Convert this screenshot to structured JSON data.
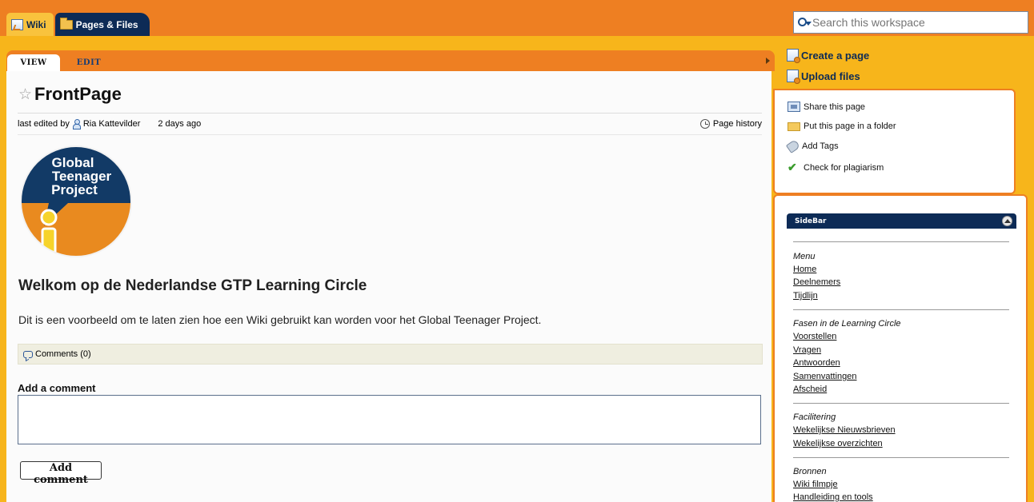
{
  "tabs": {
    "wiki": "Wiki",
    "pages_files": "Pages & Files"
  },
  "search": {
    "placeholder": "Search this workspace"
  },
  "page_tabs": {
    "view": "VIEW",
    "edit": "EDIT"
  },
  "page": {
    "title": "FrontPage",
    "last_edited_prefix": "last edited by",
    "editor": "Ria Kattevilder",
    "edited_ago": "2 days ago",
    "history": "Page history",
    "logo_lines": [
      "Global",
      "Teenager",
      "Project"
    ],
    "heading": "Welkom op de Nederlandse GTP Learning Circle",
    "paragraph": "Dit is een voorbeeld om te laten zien hoe een Wiki gebruikt kan worden voor het Global Teenager Project.",
    "comments": "Comments (0)",
    "add_comment_label": "Add a comment",
    "add_comment_button": "Add comment"
  },
  "right": {
    "create_page": "Create a page",
    "upload_files": "Upload files",
    "actions": [
      "Share this page",
      "Put this page in a folder",
      "Add Tags",
      "Check for plagiarism"
    ]
  },
  "sidebar": {
    "title": "SideBar",
    "sections": [
      {
        "heading": "Menu",
        "links": [
          "Home",
          "Deelnemers",
          "Tijdlijn"
        ]
      },
      {
        "heading": "Fasen in de Learning Circle",
        "links": [
          "Voorstellen",
          "Vragen",
          "Antwoorden",
          "Samenvattingen",
          "Afscheid"
        ]
      },
      {
        "heading": "Facilitering",
        "links": [
          "Wekelijkse Nieuwsbrieven",
          "Wekelijkse overzichten"
        ]
      },
      {
        "heading": "Bronnen",
        "links": [
          "Wiki filmpje",
          "Handleiding en tools"
        ]
      }
    ]
  },
  "colors": {
    "orange": "#ee7f22",
    "yellow": "#f7b51b",
    "navy": "#0d2b56"
  }
}
